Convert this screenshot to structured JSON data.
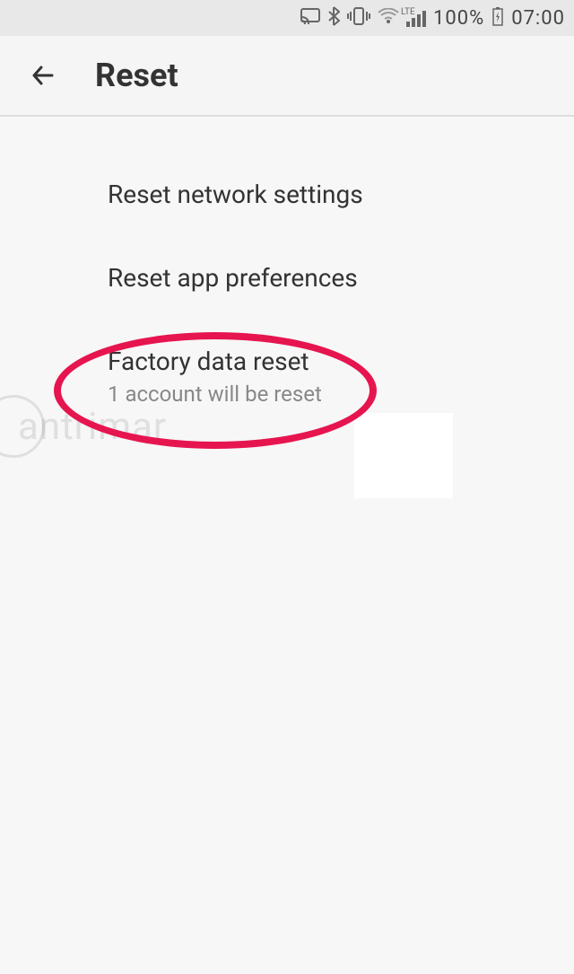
{
  "status_bar": {
    "battery_percent": "100%",
    "time": "07:00",
    "icons": {
      "cast": "cast-icon",
      "bluetooth": "bluetooth-icon",
      "vibrate": "vibrate-icon",
      "wifi": "wifi-icon",
      "lte": "LTE",
      "signal": "signal-icon",
      "battery": "battery-charging-icon"
    }
  },
  "header": {
    "title": "Reset"
  },
  "options": [
    {
      "title": "Reset network settings",
      "subtitle": ""
    },
    {
      "title": "Reset app preferences",
      "subtitle": ""
    },
    {
      "title": "Factory data reset",
      "subtitle": "1 account will be reset"
    }
  ],
  "watermark": "antrimar",
  "annotation": {
    "highlight_color": "#e6154f"
  }
}
